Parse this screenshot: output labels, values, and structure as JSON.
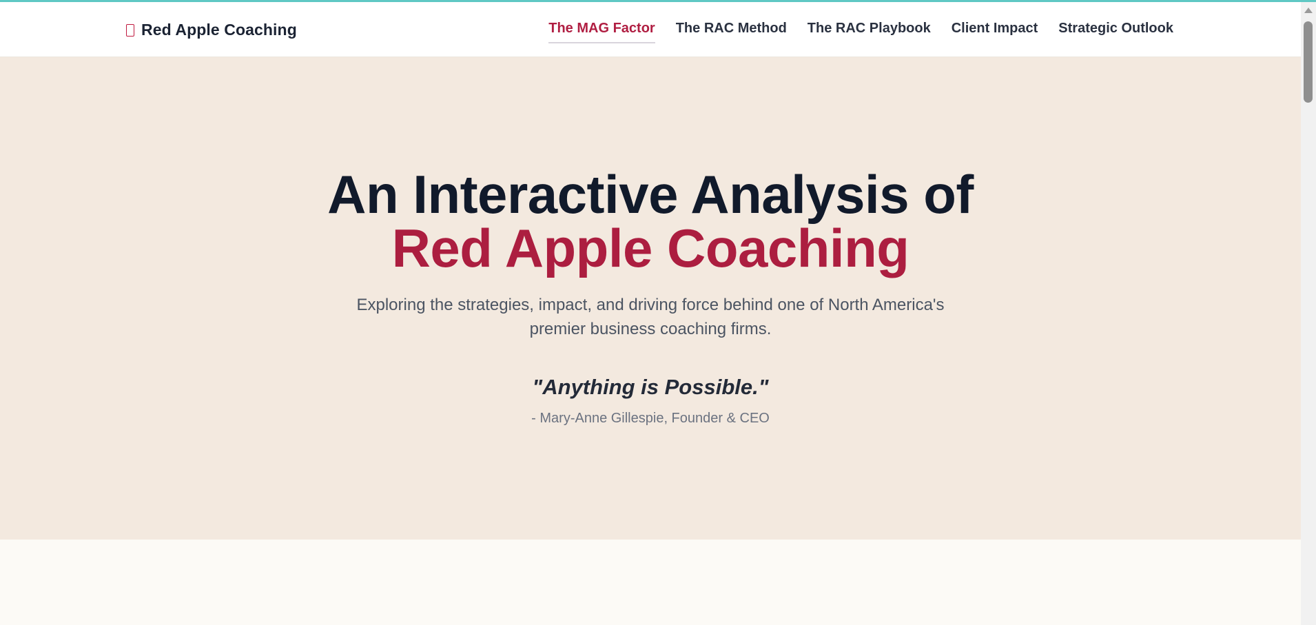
{
  "brand": {
    "name": "Red Apple Coaching",
    "icon": "apple-icon"
  },
  "nav": {
    "items": [
      {
        "label": "The MAG Factor",
        "active": true
      },
      {
        "label": "The RAC Method",
        "active": false
      },
      {
        "label": "The RAC Playbook",
        "active": false
      },
      {
        "label": "Client Impact",
        "active": false
      },
      {
        "label": "Strategic Outlook",
        "active": false
      }
    ]
  },
  "hero": {
    "title_line1": "An Interactive Analysis of",
    "title_line2": "Red Apple Coaching",
    "subtitle": "Exploring the strategies, impact, and driving force behind one of North America's premier business coaching firms.",
    "quote": "\"Anything is Possible.\"",
    "attribution": "- Mary-Anne Gillespie, Founder & CEO"
  },
  "colors": {
    "accent": "#ac1e40",
    "hero_background": "#f3e9df",
    "navbar_background": "#ffffff",
    "heading": "#111a2b",
    "top_border": "#5fc8c4"
  }
}
